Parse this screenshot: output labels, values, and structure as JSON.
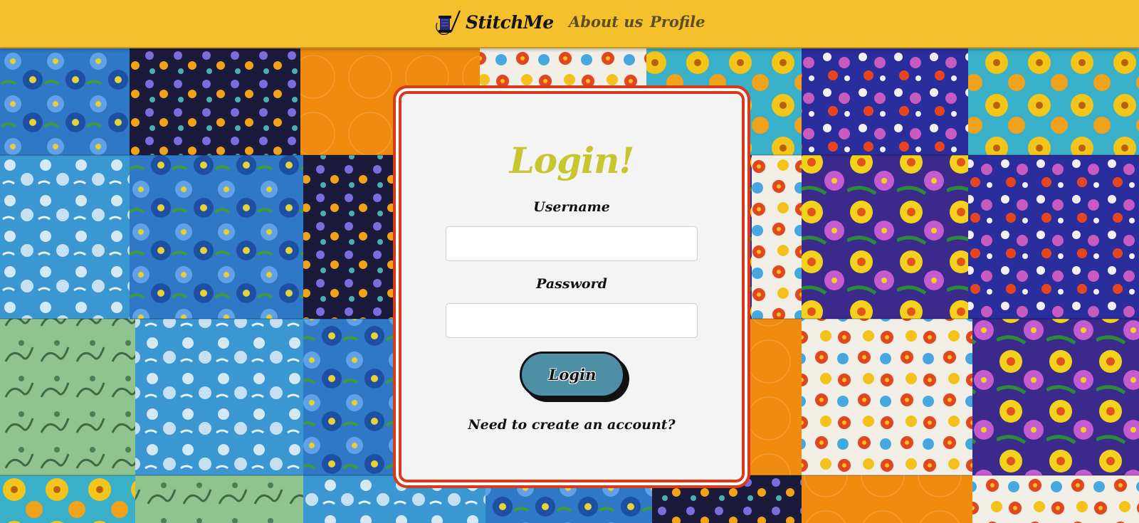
{
  "header": {
    "brand": "StitchMe",
    "brand_icon": "sewing-needle-spool-icon",
    "nav": [
      {
        "label": "About us"
      },
      {
        "label": "Profile"
      }
    ],
    "colors": {
      "bar": "#f4c12d",
      "nav_text": "#5d4d22"
    }
  },
  "background": {
    "description_icon": "floral-patchwork-quilt-image"
  },
  "login": {
    "title": "Login!",
    "username_label": "Username",
    "username_value": "",
    "password_label": "Password",
    "password_value": "",
    "submit_label": "Login",
    "signup_text": "Need to create an account?",
    "colors": {
      "title": "#c8c52e",
      "border": "#d83a1c",
      "button": "#4f8fa6"
    }
  }
}
